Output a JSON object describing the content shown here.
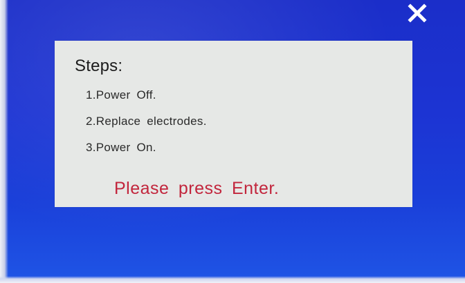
{
  "close_icon": "close-x-icon",
  "dialog": {
    "title": "Steps:",
    "steps": [
      "1.Power Off.",
      "2.Replace electrodes.",
      "3.Power On."
    ],
    "prompt": "Please press Enter."
  },
  "colors": {
    "background": "#1c34d3",
    "dialog": "#e6e8e6",
    "prompt_text": "#c2253c",
    "text": "#2a2a2a"
  }
}
